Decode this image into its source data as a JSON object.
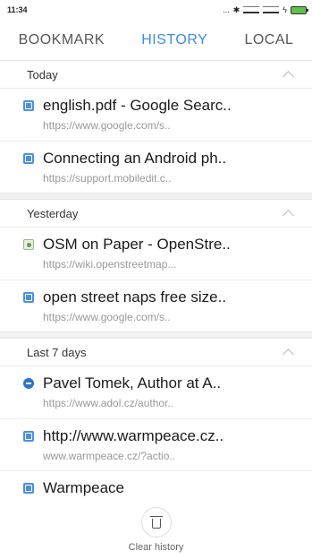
{
  "status_bar": {
    "time": "11:34",
    "dots": "...",
    "bluetooth": "ⵣ"
  },
  "tabs": [
    {
      "label": "BOOKMARK",
      "active": false
    },
    {
      "label": "HISTORY",
      "active": true
    },
    {
      "label": "LOCAL",
      "active": false
    }
  ],
  "sections": [
    {
      "header": "Today",
      "items": [
        {
          "icon": "google-favicon",
          "title": "english.pdf - Google Searc..",
          "url": "https://www.google.com/s.."
        },
        {
          "icon": "mobiledit-favicon",
          "title": "Connecting an Android ph..",
          "url": "https://support.mobiledit.c.."
        }
      ]
    },
    {
      "header": "Yesterday",
      "items": [
        {
          "icon": "osm-favicon",
          "title": "OSM on Paper - OpenStre..",
          "url": "https://wiki.openstreetmap..."
        },
        {
          "icon": "google-favicon",
          "title": "open street naps free size..",
          "url": "https://www.google.com/s.."
        }
      ]
    },
    {
      "header": "Last 7 days",
      "items": [
        {
          "icon": "adol-favicon",
          "title": "Pavel Tomek, Author at A..",
          "url": "https://www.adol.cz/author.."
        },
        {
          "icon": "warmpeace-favicon",
          "title": "http://www.warmpeace.cz..",
          "url": "www.warmpeace.cz/?actio.."
        },
        {
          "icon": "warmpeace-favicon",
          "title": "Warmpeace",
          "url": ""
        }
      ]
    }
  ],
  "bottom": {
    "clear_label": "Clear history"
  },
  "colors": {
    "accent": "#3c8ce6",
    "favicon_blue": "#4a90e2"
  }
}
